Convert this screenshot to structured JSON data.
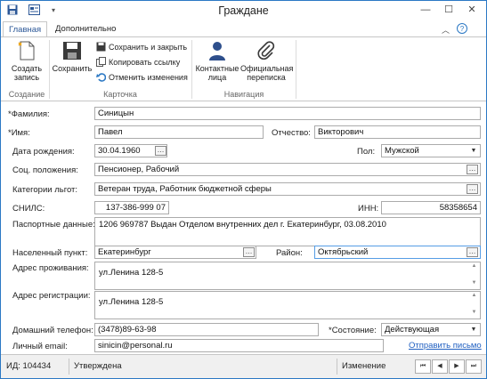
{
  "window": {
    "title": "Граждане"
  },
  "tabs": [
    {
      "label": "Главная"
    },
    {
      "label": "Дополнительно"
    }
  ],
  "ribbon": {
    "groups": [
      {
        "label": "Создание"
      },
      {
        "label": "Карточка"
      },
      {
        "label": "Навигация"
      }
    ],
    "create_label": "Создать запись",
    "save_label": "Сохранить",
    "save_close_label": "Сохранить и закрыть",
    "copy_link_label": "Копировать ссылку",
    "undo_label": "Отменить изменения",
    "contacts_label": "Контактные лица",
    "correspondence_label": "Официальная переписка"
  },
  "form": {
    "surname": {
      "label": "*Фамилия:",
      "value": "Синицын"
    },
    "name": {
      "label": "*Имя:",
      "value": "Павел"
    },
    "patronymic": {
      "label": "Отчество:",
      "value": "Викторович"
    },
    "birthdate": {
      "label": "Дата рождения:",
      "value": "30.04.1960"
    },
    "gender": {
      "label": "Пол:",
      "value": "Мужской"
    },
    "social": {
      "label": "Соц. положения:",
      "value": "Пенсионер, Рабочий"
    },
    "benefits": {
      "label": "Категории льгот:",
      "value": "Ветеран труда, Работник бюджетной сферы"
    },
    "snils": {
      "label": "СНИЛС:",
      "value": "137-386-999 07"
    },
    "inn": {
      "label": "ИНН:",
      "value": "58358654"
    },
    "passport": {
      "label": "Паспортные данные:",
      "value": "1206 969787 Выдан Отделом внутренних дел г. Екатеринбург, 03.08.2010"
    },
    "locality": {
      "label": "Населенный пункт:",
      "value": "Екатеринбург"
    },
    "district": {
      "label": "Район:",
      "value": "Октябрьский"
    },
    "residence": {
      "label": "Адрес проживания:",
      "value": "ул.Ленина 128-5"
    },
    "registration": {
      "label": "Адрес регистрации:",
      "value": "ул.Ленина 128-5"
    },
    "phone": {
      "label": "Домашний телефон:",
      "value": "(3478)89-63-98"
    },
    "state": {
      "label": "*Состояние:",
      "value": "Действующая"
    },
    "email": {
      "label": "Личный email:",
      "value": "sinicin@personal.ru"
    },
    "send_letter": "Отправить письмо"
  },
  "status": {
    "id": "ИД: 104434",
    "state": "Утверждена",
    "mode": "Изменение"
  },
  "colors": {
    "accent": "#2b78c4",
    "link": "#1f5fc1"
  }
}
